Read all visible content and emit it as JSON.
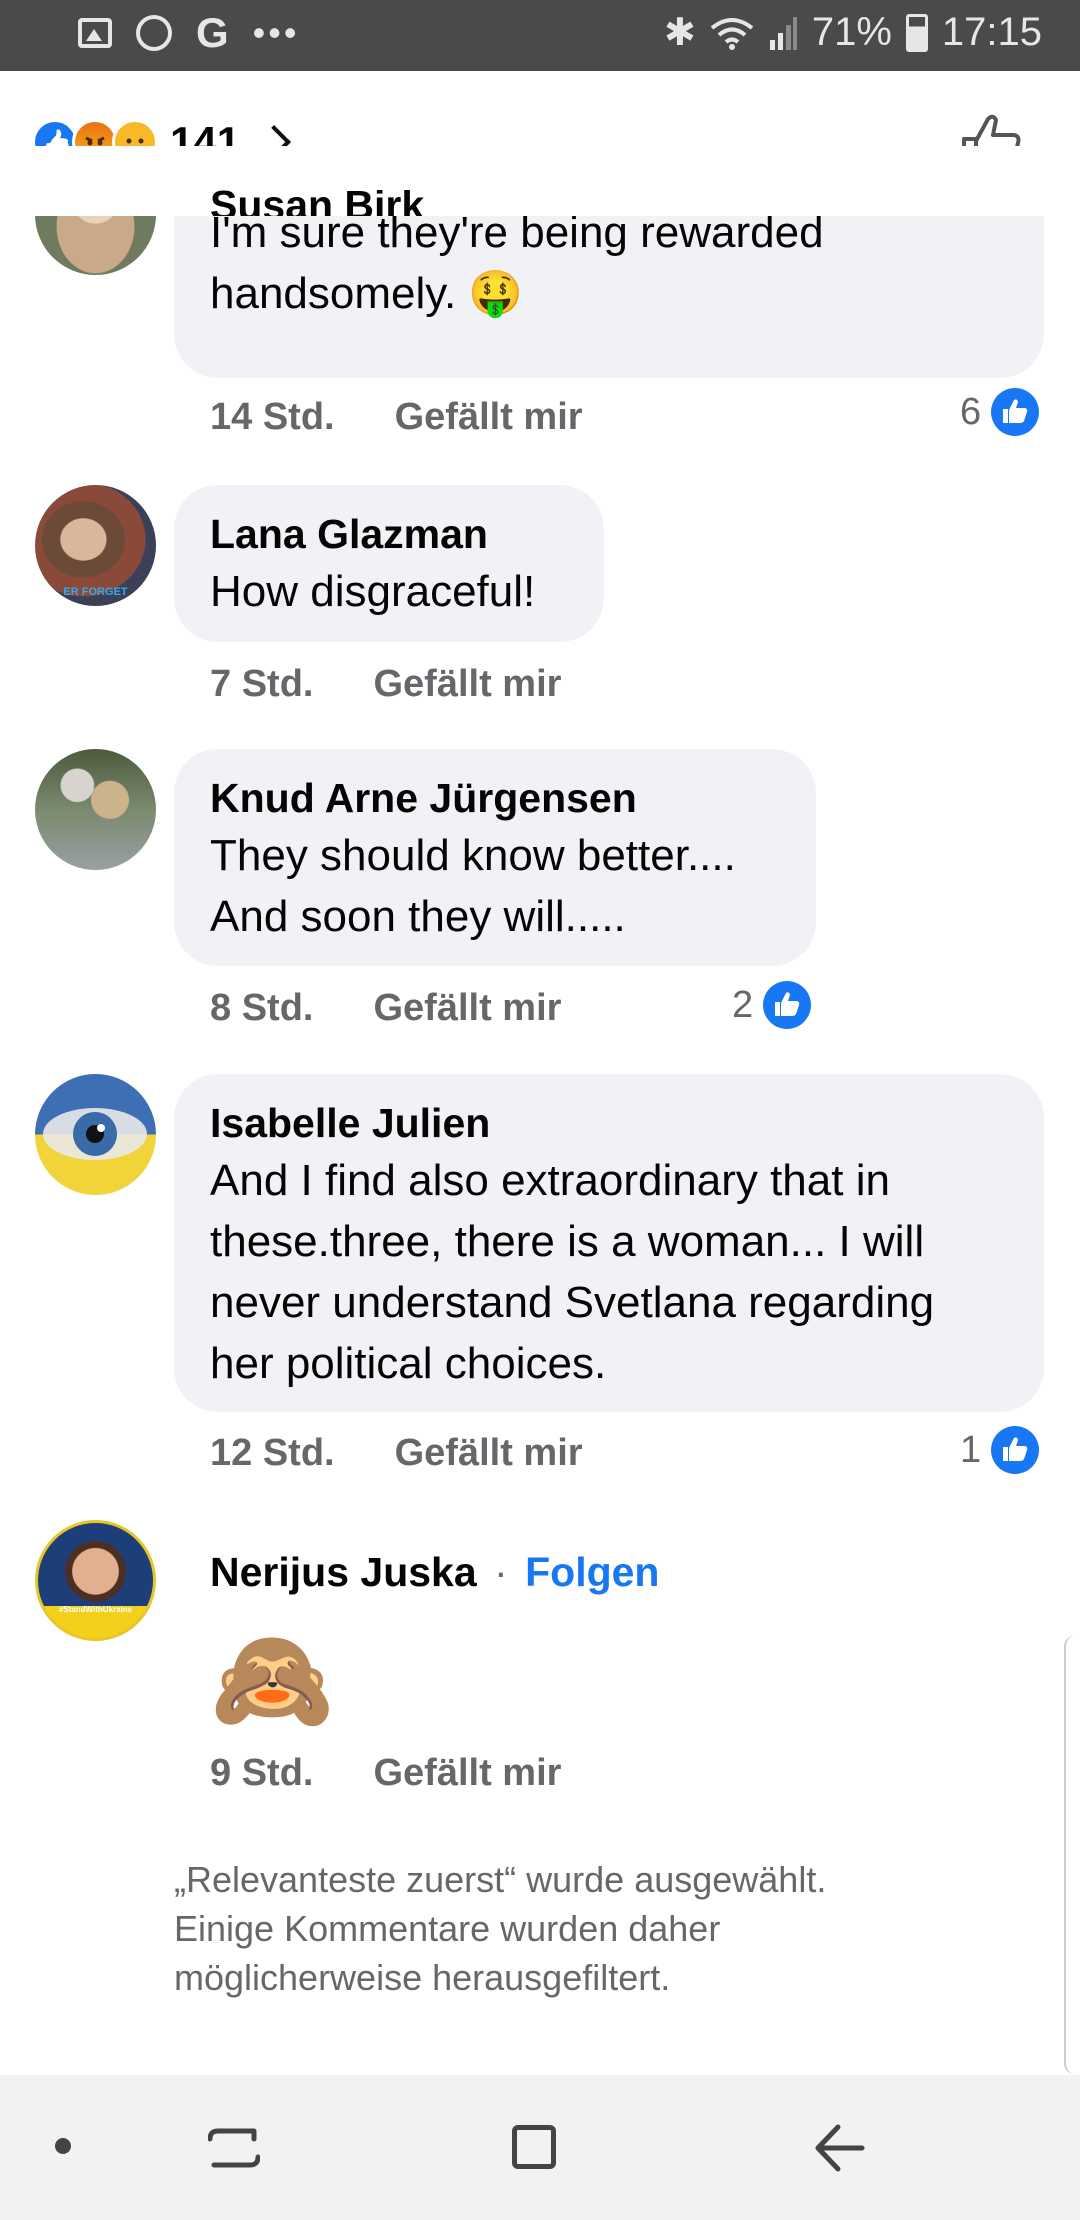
{
  "status_bar": {
    "battery": "71%",
    "time": "17:15",
    "icons": [
      "gallery-icon",
      "whatsapp-icon",
      "google-icon",
      "more-icon",
      "bluetooth-icon",
      "wifi-icon",
      "signal-icon",
      "battery-icon"
    ]
  },
  "header": {
    "reactions": [
      "like",
      "angry",
      "sad"
    ],
    "reaction_count": "141",
    "colors": {
      "like": "#1877f2",
      "angry": "#e9710f",
      "sad": "#f7b928"
    }
  },
  "comments": [
    {
      "author": "Susan Birk",
      "text_line1": "I'm sure they're being rewarded",
      "text_line2": "handsomely. 🤑",
      "time": "14 Std.",
      "like_label": "Gefällt mir",
      "likes": "6"
    },
    {
      "author": "Lana Glazman",
      "text_line1": "How disgraceful!",
      "time": "7 Std.",
      "like_label": "Gefällt mir",
      "avatar_caption": "ER FORGET"
    },
    {
      "author": "Knud Arne Jürgensen",
      "text_line1": "They should know better....",
      "text_line2": "And soon they will.....",
      "time": "8 Std.",
      "like_label": "Gefällt mir",
      "likes": "2"
    },
    {
      "author": "Isabelle Julien",
      "text_line1": "And I find also extraordinary that in",
      "text_line2": "these.three, there is a woman... I will",
      "text_line3": "never understand Svetlana regarding",
      "text_line4": "her political choices.",
      "time": "12 Std.",
      "like_label": "Gefällt mir",
      "likes": "1"
    },
    {
      "author": "Nerijus Juska",
      "separator": "·",
      "follow_label": "Folgen",
      "emoji": "🙈",
      "time": "9 Std.",
      "like_label": "Gefällt mir",
      "avatar_caption": "#StandWithUkraine"
    }
  ],
  "footer_note": {
    "line1": "„Relevanteste zuerst“ wurde ausgewählt.",
    "line2": "Einige Kommentare wurden daher",
    "line3": "möglicherweise herausgefiltert."
  },
  "nav_bar": {
    "buttons": [
      "dot-icon",
      "recents-icon",
      "home-icon",
      "back-icon"
    ]
  }
}
